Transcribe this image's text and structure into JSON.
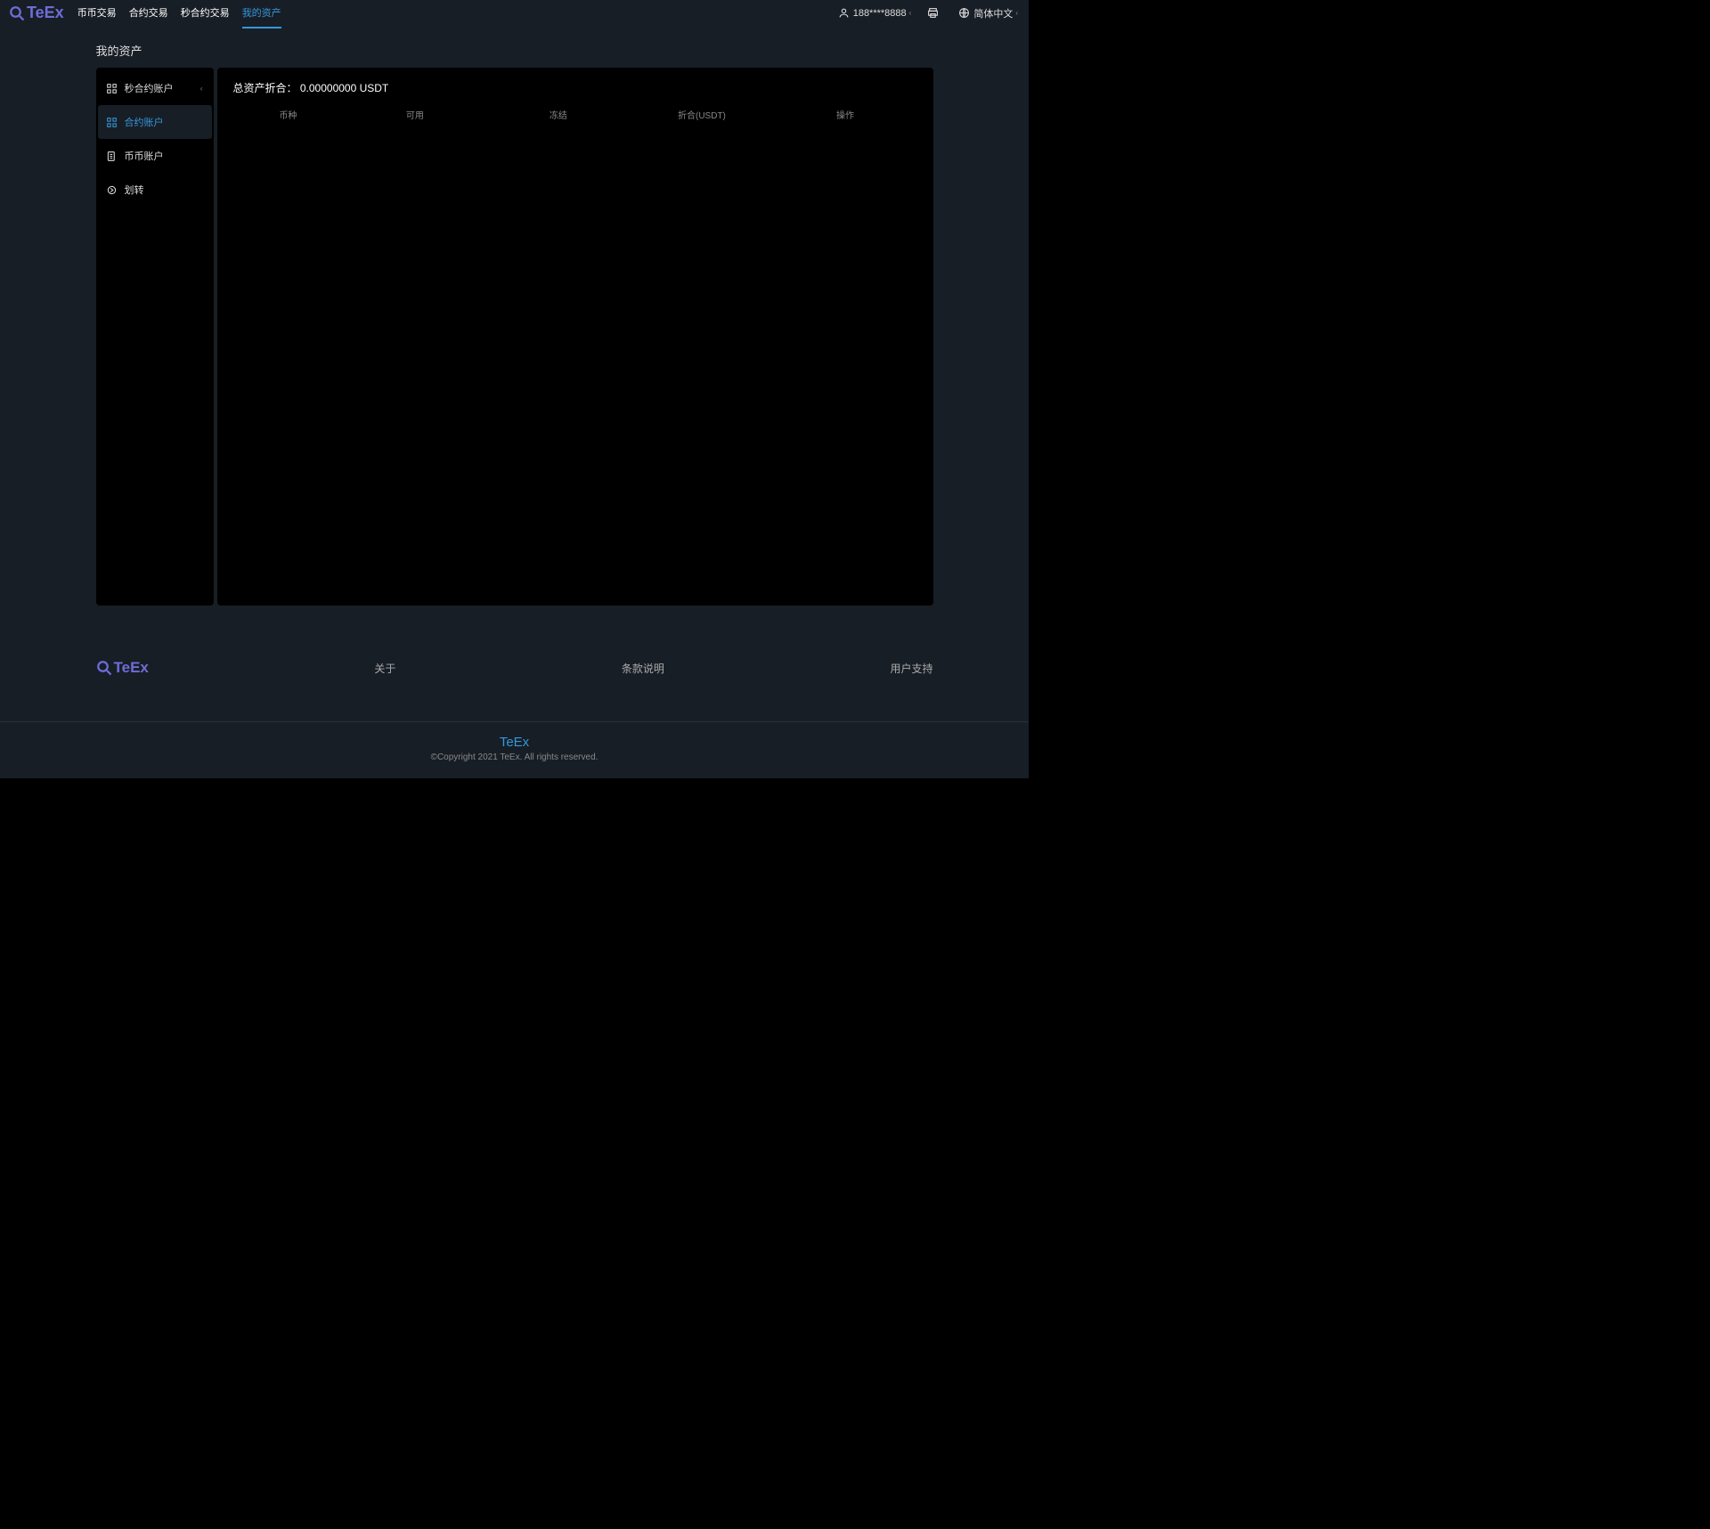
{
  "header": {
    "logo_text": "TeEx",
    "nav": [
      {
        "label": "币币交易",
        "active": false
      },
      {
        "label": "合约交易",
        "active": false
      },
      {
        "label": "秒合约交易",
        "active": false
      },
      {
        "label": "我的资产",
        "active": true
      }
    ],
    "user_label": "188****8888",
    "language": "简体中文"
  },
  "page": {
    "title": "我的资产"
  },
  "sidebar": {
    "items": [
      {
        "label": "秒合约账户",
        "icon": "grid-icon",
        "active": false,
        "has_dropdown": true
      },
      {
        "label": "合约账户",
        "icon": "grid-icon",
        "active": true,
        "has_dropdown": false
      },
      {
        "label": "币币账户",
        "icon": "doc-icon",
        "active": false,
        "has_dropdown": false
      },
      {
        "label": "划转",
        "icon": "transfer-icon",
        "active": false,
        "has_dropdown": false
      }
    ]
  },
  "main": {
    "total_label": "总资产折合：",
    "total_value": "0.00000000 USDT",
    "columns": {
      "coin": "币种",
      "available": "可用",
      "frozen": "冻结",
      "converted": "折合(USDT)",
      "operation": "操作"
    }
  },
  "footer": {
    "logo_text": "TeEx",
    "links": {
      "about": "关于",
      "terms": "条款说明",
      "support": "用户支持"
    },
    "brand": "TeEx",
    "copyright": "©Copyright 2021 TeEx. All rights reserved."
  }
}
